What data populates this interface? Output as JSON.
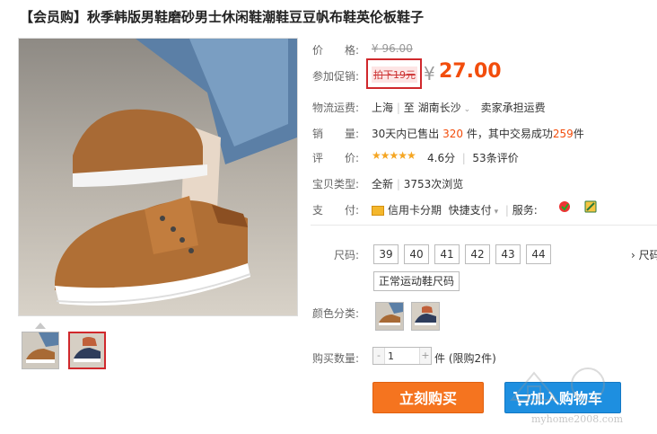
{
  "product": {
    "title": "【会员购】秋季韩版男鞋磨砂男士休闲鞋潮鞋豆豆帆布鞋英伦板鞋子"
  },
  "price": {
    "label": "价　　格:",
    "original_currency": "¥",
    "original": "96.00",
    "promo_label": "参加促销:",
    "promo_tag": "拍下19元",
    "currency": "¥",
    "promo_price": "27.00"
  },
  "shipping": {
    "label": "物流运费:",
    "from": "上海",
    "to_word": "至",
    "to": "湖南长沙",
    "fee": "卖家承担运费"
  },
  "sales": {
    "label": "销　　量:",
    "prefix": "30天内已售出",
    "sold": "320",
    "middle": "件，其中交易成功",
    "success": "259",
    "suffix": "件"
  },
  "rating": {
    "label": "评　　价:",
    "stars": "★★★★★",
    "score": "4.6分",
    "reviews": "53条评价",
    "value": 4.6
  },
  "type": {
    "label": "宝贝类型:",
    "condition": "全新",
    "views": "3753次浏览"
  },
  "payment": {
    "label": "支　　付:",
    "credit": "信用卡分期",
    "quick": "快捷支付",
    "service_label": "服务:"
  },
  "sku": {
    "size_label": "尺码:",
    "sizes": [
      "39",
      "40",
      "41",
      "42",
      "43",
      "44"
    ],
    "size_chart": "正常运动鞋尺码",
    "more": "› 尺码",
    "color_label": "颜色分类:",
    "qty_label": "购买数量:",
    "qty_value": "1",
    "qty_minus": "-",
    "qty_plus": "+",
    "qty_unit": "件 (限购2件)"
  },
  "actions": {
    "buy": "立刻购买",
    "cart": "加入购物车"
  },
  "watermark": {
    "url": "myhome2008.com"
  },
  "colors": {
    "accent": "#f24d0c",
    "buy": "#f5741f",
    "cart": "#1e8fe0",
    "highlight": "#d0282c"
  }
}
